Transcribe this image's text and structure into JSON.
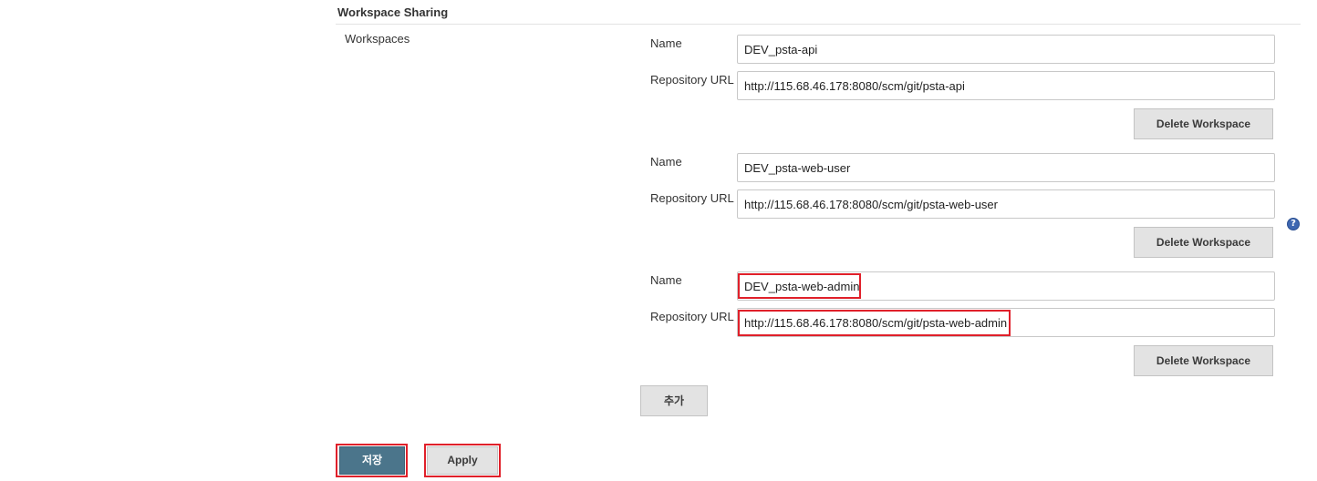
{
  "section": {
    "title": "Workspace Sharing",
    "workspaces_label": "Workspaces"
  },
  "workspaces": [
    {
      "name_label": "Name",
      "name_value": "DEV_psta-api",
      "url_label": "Repository URL",
      "url_value": "http://115.68.46.178:8080/scm/git/psta-api",
      "delete_label": "Delete Workspace"
    },
    {
      "name_label": "Name",
      "name_value": "DEV_psta-web-user",
      "url_label": "Repository URL",
      "url_value": "http://115.68.46.178:8080/scm/git/psta-web-user",
      "delete_label": "Delete Workspace"
    },
    {
      "name_label": "Name",
      "name_value": "DEV_psta-web-admin",
      "url_label": "Repository URL",
      "url_value": "http://115.68.46.178:8080/scm/git/psta-web-admin",
      "delete_label": "Delete Workspace"
    }
  ],
  "add_label": "추가",
  "help_glyph": "?",
  "footer": {
    "save_label": "저장",
    "apply_label": "Apply"
  },
  "colors": {
    "highlight": "#e0202a",
    "save_button": "#4b758b",
    "help_icon": "#3e67b1"
  }
}
